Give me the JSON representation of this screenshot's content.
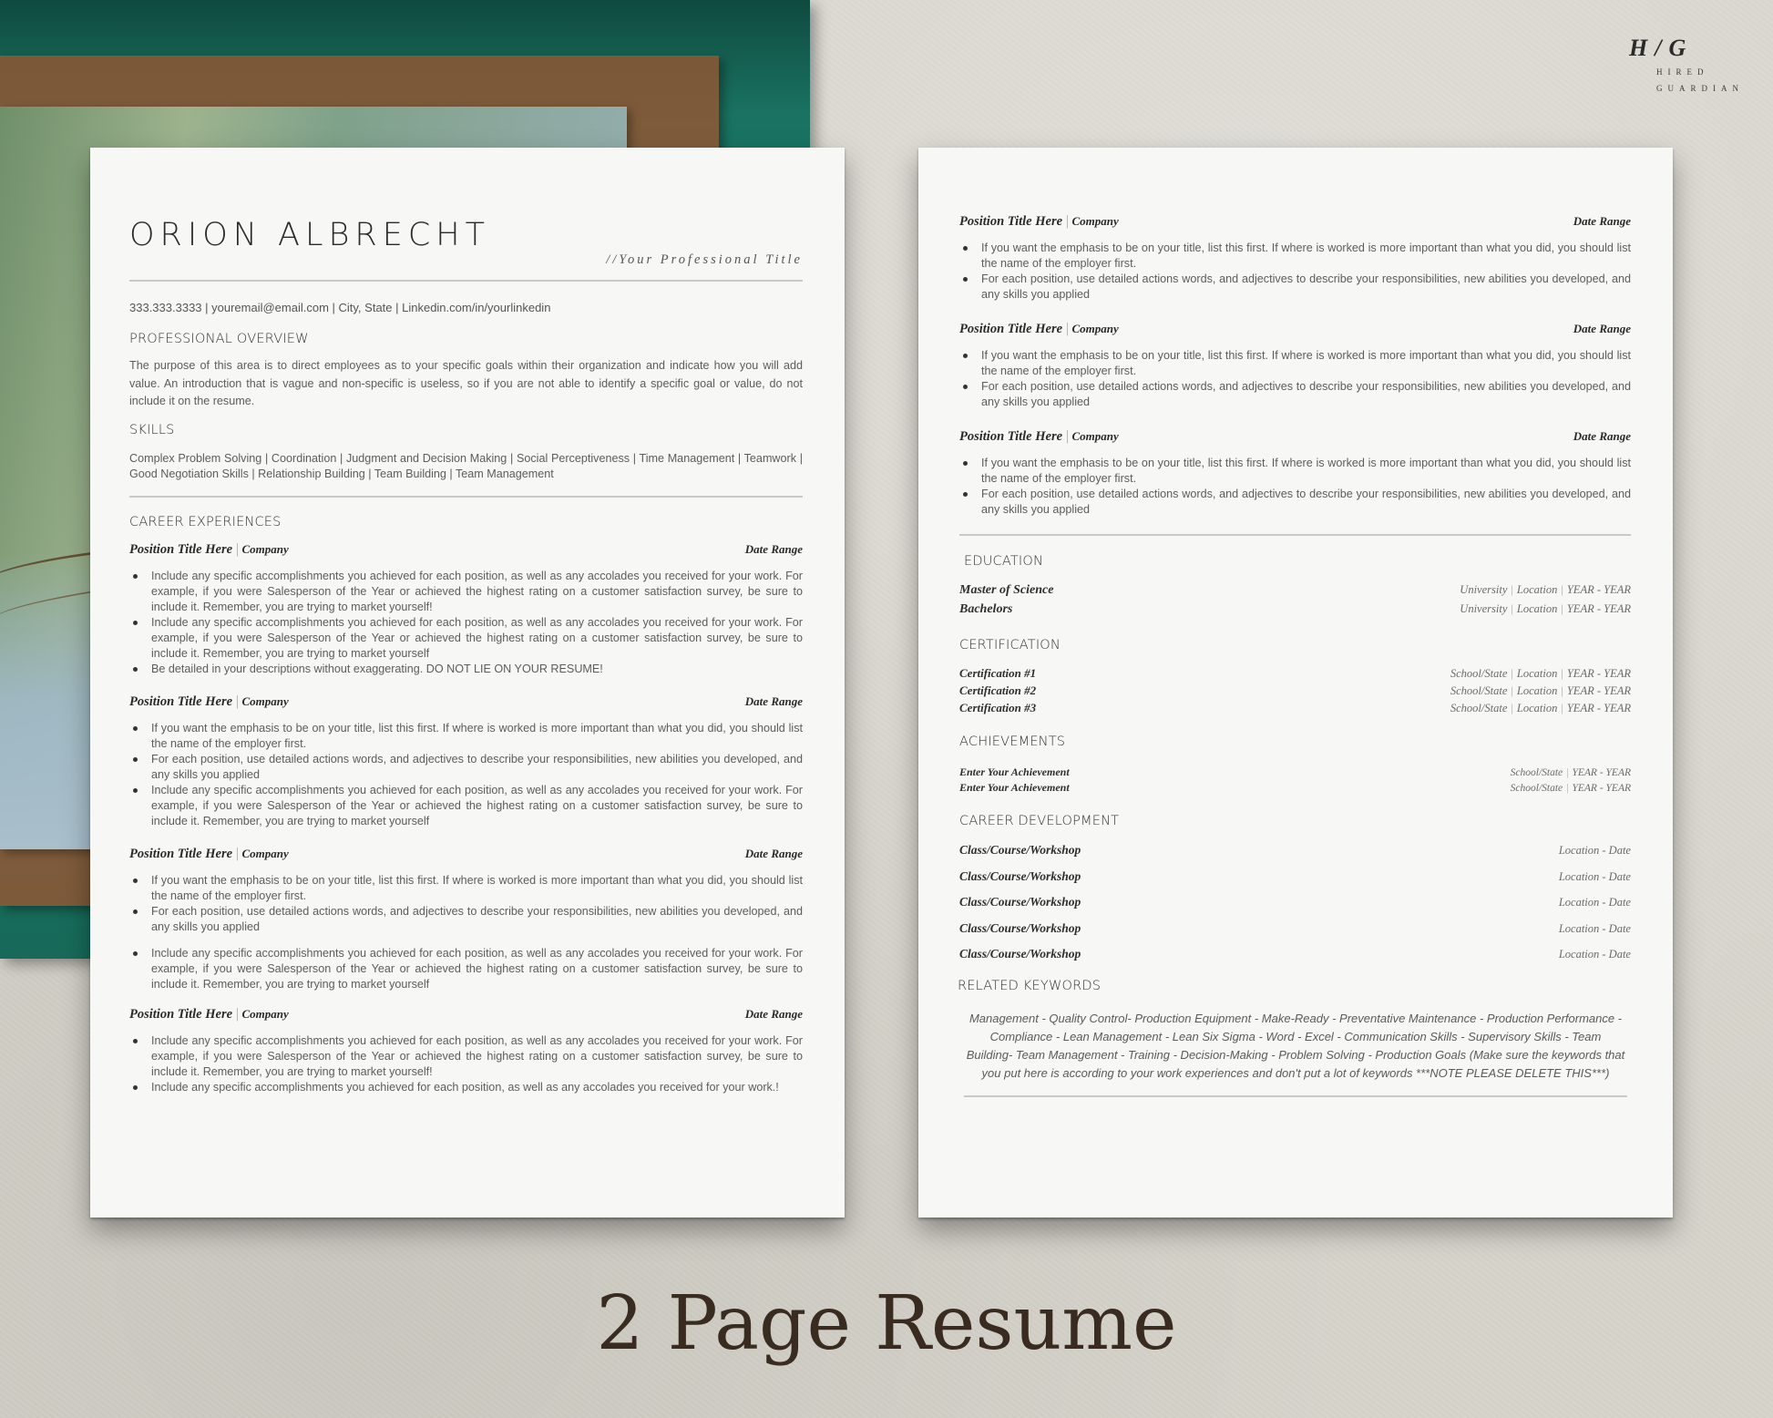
{
  "logo": {
    "monogram": "H/G",
    "line1": "HIRED",
    "line2": "GUARDIAN"
  },
  "caption": "2 Page Resume",
  "page1": {
    "name": "ORION ALBRECHT",
    "professional_title": "//Your Professional Title",
    "contact": "333.333.3333 | youremail@email.com | City, State | Linkedin.com/in/yourlinkedin",
    "overview_heading": "PROFESSIONAL OVERVIEW",
    "overview_text": "The purpose of this area is to direct employees as to your specific goals within their organization and indicate how you will add value. An introduction that is vague and non-specific is useless, so if you are not able to identify a specific goal or value, do not include it on the resume.",
    "skills_heading": "SKILLS",
    "skills_text": "Complex Problem Solving | Coordination | Judgment and Decision Making | Social Perceptiveness | Time Management | Teamwork | Good Negotiation Skills | Relationship Building | Team Building | Team Management",
    "career_heading": "CAREER EXPERIENCES",
    "jobs": [
      {
        "title": "Position Title Here",
        "company": "Company",
        "date": "Date Range",
        "bullets": [
          "Include any specific accomplishments you achieved for each position, as well as any accolades you received for your work. For example, if you were Salesperson of the Year or achieved the highest rating on a customer satisfaction survey, be sure to include it.  Remember, you are trying to market yourself!",
          "Include any specific accomplishments you achieved for each position, as well as any accolades you received for your work. For example, if you were Salesperson of the Year or achieved the highest rating on a customer satisfaction survey, be sure to include it.  Remember, you are trying to market yourself",
          "Be detailed in your descriptions without exaggerating.  DO NOT LIE ON YOUR RESUME!"
        ]
      },
      {
        "title": "Position Title Here",
        "company": "Company",
        "date": "Date Range",
        "bullets": [
          "If you want the emphasis to be on your title, list this first.  If where is worked is more important than what you did, you should list the name of the employer first.",
          "For each position, use detailed actions words, and adjectives to describe your responsibilities, new abilities you developed, and any skills you applied",
          "Include any specific accomplishments you achieved for each position, as well as any accolades you received for your work. For example, if you were Salesperson of the Year or achieved the highest rating on a customer satisfaction survey, be sure to include it.  Remember, you are trying to market yourself"
        ]
      },
      {
        "title": "Position Title Here",
        "company": "Company",
        "date": "Date Range",
        "bullets": [
          "If you want the emphasis to be on your title, list this first.  If where is worked is more important than what you did, you should list the name of the employer first.",
          "For each position, use detailed actions words, and adjectives to describe your responsibilities, new abilities you developed, and any skills you applied",
          "Include any specific accomplishments you achieved for each position, as well as any accolades you received for your work. For example, if you were Salesperson of the Year or achieved the highest rating on a customer satisfaction survey, be sure to include it.  Remember, you are trying to market yourself"
        ]
      },
      {
        "title": "Position Title Here",
        "company": "Company",
        "date": "Date Range",
        "bullets": [
          "Include any specific accomplishments you achieved for each position, as well as any accolades you received for your work. For example, if you were Salesperson of the Year or achieved the highest rating on a customer satisfaction survey, be sure to include it.  Remember, you are trying to market yourself!",
          "Include any specific accomplishments you achieved for each position, as well as any accolades you received for your work.!"
        ]
      }
    ]
  },
  "page2": {
    "jobs": [
      {
        "title": "Position Title Here",
        "company": "Company",
        "date": "Date Range",
        "bullets": [
          "If you want the emphasis to be on your title, list this first.  If where is worked is more important than what you did, you should list the name of the employer first.",
          "For each position, use detailed actions words, and adjectives to describe your responsibilities, new abilities you developed, and any skills you applied"
        ]
      },
      {
        "title": "Position Title Here",
        "company": "Company",
        "date": "Date Range",
        "bullets": [
          "If you want the emphasis to be on your title, list this first.  If where is worked is more important than what you did, you should list the name of the employer first.",
          "For each position, use detailed actions words, and adjectives to describe your responsibilities, new abilities you developed, and any skills you applied"
        ]
      },
      {
        "title": "Position Title Here",
        "company": "Company",
        "date": "Date Range",
        "bullets": [
          "If you want the emphasis to be on your title, list this first.  If where is worked is more important than what you did, you should list the name of the employer first.",
          "For each position, use detailed actions words, and adjectives to describe your responsibilities, new abilities you developed, and any skills you applied"
        ]
      }
    ],
    "education_heading": "EDUCATION",
    "education": [
      {
        "degree": "Master of Science",
        "school": "University",
        "location": "Location",
        "years": "YEAR - YEAR"
      },
      {
        "degree": "Bachelors",
        "school": "University",
        "location": "Location",
        "years": "YEAR - YEAR"
      }
    ],
    "certification_heading": "CERTIFICATION",
    "certifications": [
      {
        "name": "Certification  #1",
        "school": "School/State",
        "location": "Location",
        "years": "YEAR - YEAR"
      },
      {
        "name": "Certification  #2",
        "school": "School/State",
        "location": "Location",
        "years": "YEAR - YEAR"
      },
      {
        "name": "Certification  #3",
        "school": "School/State",
        "location": "Location",
        "years": "YEAR - YEAR"
      }
    ],
    "achievements_heading": "ACHIEVEMENTS",
    "achievements": [
      {
        "name": "Enter Your Achievement",
        "school": "School/State",
        "years": "YEAR - YEAR"
      },
      {
        "name": "Enter Your Achievement",
        "school": "School/State",
        "years": "YEAR - YEAR"
      }
    ],
    "career_dev_heading": "CAREER DEVELOPMENT",
    "courses": [
      {
        "name": "Class/Course/Workshop",
        "detail": "Location - Date"
      },
      {
        "name": "Class/Course/Workshop",
        "detail": "Location - Date"
      },
      {
        "name": "Class/Course/Workshop",
        "detail": "Location - Date"
      },
      {
        "name": "Class/Course/Workshop",
        "detail": "Location - Date"
      },
      {
        "name": "Class/Course/Workshop",
        "detail": "Location - Date"
      }
    ],
    "keywords_heading": "RELATED KEYWORDS",
    "keywords_text": "Management - Quality Control- Production Equipment - Make-Ready - Preventative Maintenance - Production Performance - Compliance - Lean Management - Lean Six Sigma - Word - Excel - Communication Skills - Supervisory Skills - Team Building- Team Management - Training - Decision-Making - Problem Solving - Production Goals (Make sure the keywords that you put here is according to your work experiences and don't put a lot of keywords ***NOTE PLEASE DELETE THIS***)"
  }
}
